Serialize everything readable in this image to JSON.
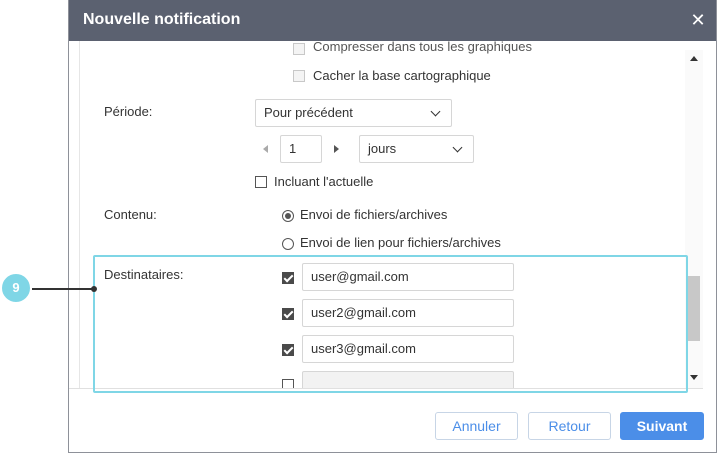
{
  "dialog": {
    "title": "Nouvelle notification",
    "close_icon": "close-icon"
  },
  "options": {
    "partial_label": "Compresser dans tous les graphiques",
    "hide_map_label": "Cacher la base cartographique"
  },
  "period": {
    "label": "Période:",
    "mode_value": "Pour précédent",
    "count_value": "1",
    "unit_value": "jours",
    "include_current_label": "Incluant l'actuelle",
    "include_current_checked": false
  },
  "content": {
    "label": "Contenu:",
    "options": [
      {
        "label": "Envoi de fichiers/archives",
        "selected": true
      },
      {
        "label": "Envoi de lien pour fichiers/archives",
        "selected": false
      }
    ]
  },
  "recipients": {
    "label": "Destinataires:",
    "items": [
      {
        "checked": true,
        "email": "user@gmail.com"
      },
      {
        "checked": true,
        "email": "user2@gmail.com"
      },
      {
        "checked": true,
        "email": "user3@gmail.com"
      },
      {
        "checked": false,
        "email": ""
      }
    ]
  },
  "annotation": {
    "number": "9",
    "color": "#7fd6e6"
  },
  "footer": {
    "cancel_label": "Annuler",
    "back_label": "Retour",
    "next_label": "Suivant"
  },
  "colors": {
    "titlebar": "#5b6170",
    "primary": "#4b8ee8",
    "highlight": "#7fd6e6"
  }
}
